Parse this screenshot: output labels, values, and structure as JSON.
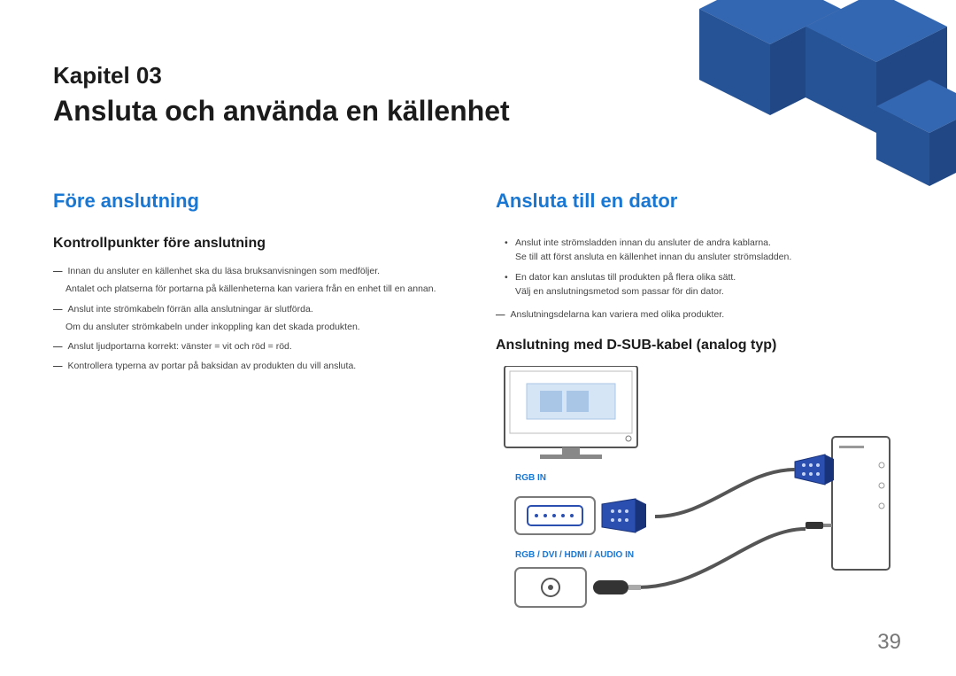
{
  "chapter_label": "Kapitel 03",
  "chapter_title": "Ansluta och använda en källenhet",
  "left": {
    "heading": "Före anslutning",
    "subheading": "Kontrollpunkter före anslutning",
    "notes": [
      {
        "main": "Innan du ansluter en källenhet ska du läsa bruksanvisningen som medföljer.",
        "sub": "Antalet och platserna för portarna på källenheterna kan variera från en enhet till en annan."
      },
      {
        "main": "Anslut inte strömkabeln förrän alla anslutningar är slutförda.",
        "sub": "Om du ansluter strömkabeln under inkoppling kan det skada produkten."
      },
      {
        "main": "Anslut ljudportarna korrekt: vänster = vit och röd = röd."
      },
      {
        "main": "Kontrollera typerna av portar på baksidan av produkten du vill ansluta."
      }
    ]
  },
  "right": {
    "heading": "Ansluta till en dator",
    "bullets": [
      {
        "main": "Anslut inte strömsladden innan du ansluter de andra kablarna.",
        "sub": "Se till att först ansluta en källenhet innan du ansluter strömsladden."
      },
      {
        "main": "En dator kan anslutas till produkten på flera olika sätt.",
        "sub": "Välj en anslutningsmetod som passar för din dator."
      }
    ],
    "note": "Anslutningsdelarna kan variera med olika produkter.",
    "subheading": "Anslutning med D-SUB-kabel (analog typ)",
    "port1_label": "RGB IN",
    "port2_label": "RGB / DVI / HDMI / AUDIO IN"
  },
  "page_number": "39"
}
